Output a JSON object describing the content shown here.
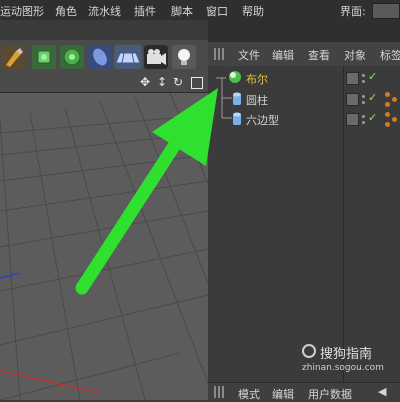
{
  "menu": {
    "items": [
      "运动图形",
      "角色",
      "流水线",
      "插件",
      "脚本",
      "窗口",
      "帮助"
    ],
    "layout_label": "界面:"
  },
  "panel_menu": {
    "items": [
      "文件",
      "编辑",
      "查看",
      "对象",
      "标签"
    ]
  },
  "objects": [
    {
      "name": "布尔",
      "color": "#e8c23a"
    },
    {
      "name": "圆柱",
      "color": "#d6d6d6"
    },
    {
      "name": "六边型",
      "color": "#d6d6d6"
    }
  ],
  "bottom_panel": {
    "items": [
      "模式",
      "编辑",
      "用户数据"
    ]
  },
  "watermark": {
    "brand": "搜狗指南",
    "url": "zhinan.sogou.com"
  },
  "colors": {
    "arrow": "#2fe02f",
    "accent_selected": "#e8c23a"
  }
}
